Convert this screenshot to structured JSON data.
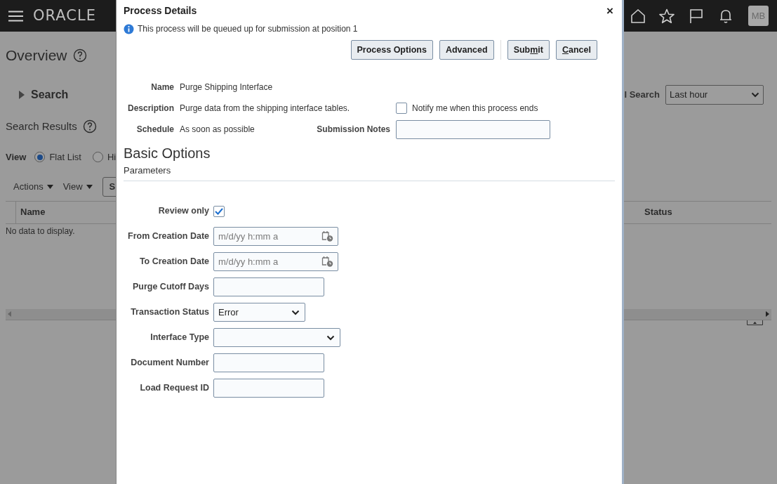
{
  "header": {
    "logo": "ORACLE",
    "avatar": "MB"
  },
  "page": {
    "title": "Overview",
    "search_section": {
      "label": "Search",
      "expanded": false
    },
    "saved_search": {
      "label": "l Search",
      "value": "Last hour"
    },
    "results_title": "Search Results",
    "view": {
      "label": "View",
      "options": [
        {
          "label": "Flat List",
          "selected": true
        },
        {
          "label": "Hi",
          "selected": false
        }
      ]
    },
    "toolbar": [
      {
        "label": "Actions",
        "kind": "menu"
      },
      {
        "label": "View",
        "kind": "menu"
      },
      {
        "label": "S",
        "kind": "button"
      }
    ],
    "table": {
      "columns": [
        "Name",
        "Status"
      ],
      "empty_message": "No data to display."
    }
  },
  "dialog": {
    "title": "Process Details",
    "close": "×",
    "info": "This process will be queued up for submission at position 1",
    "option_buttons": [
      {
        "before": "Process Options"
      },
      {
        "before": "Advanced"
      }
    ],
    "action_buttons": [
      {
        "before": "Sub",
        "key": "m",
        "after": "it"
      },
      {
        "key": "C",
        "after": "ancel"
      }
    ],
    "details": [
      {
        "label": "Name",
        "value": "Purge Shipping Interface"
      },
      {
        "label": "Description",
        "value": "Purge data from the shipping interface tables."
      },
      {
        "label": "Schedule",
        "value": "As soon as possible"
      }
    ],
    "notify": {
      "label": "Notify me when this process ends",
      "checked": false
    },
    "submission_notes": {
      "label": "Submission Notes"
    },
    "section_title": "Basic Options",
    "subsection_title": "Parameters",
    "parameters": [
      {
        "label": "Review only",
        "kind": "checkbox",
        "checked": true
      },
      {
        "label": "From Creation Date",
        "kind": "date",
        "placeholder": "m/d/yy h:mm a"
      },
      {
        "label": "To Creation Date",
        "kind": "date",
        "placeholder": "m/d/yy h:mm a"
      },
      {
        "label": "Purge Cutoff Days",
        "kind": "text"
      },
      {
        "label": "Transaction Status",
        "kind": "select",
        "value": "Error"
      },
      {
        "label": "Interface Type",
        "kind": "dropdown"
      },
      {
        "label": "Document Number",
        "kind": "text"
      },
      {
        "label": "Load Request ID",
        "kind": "text"
      }
    ]
  }
}
